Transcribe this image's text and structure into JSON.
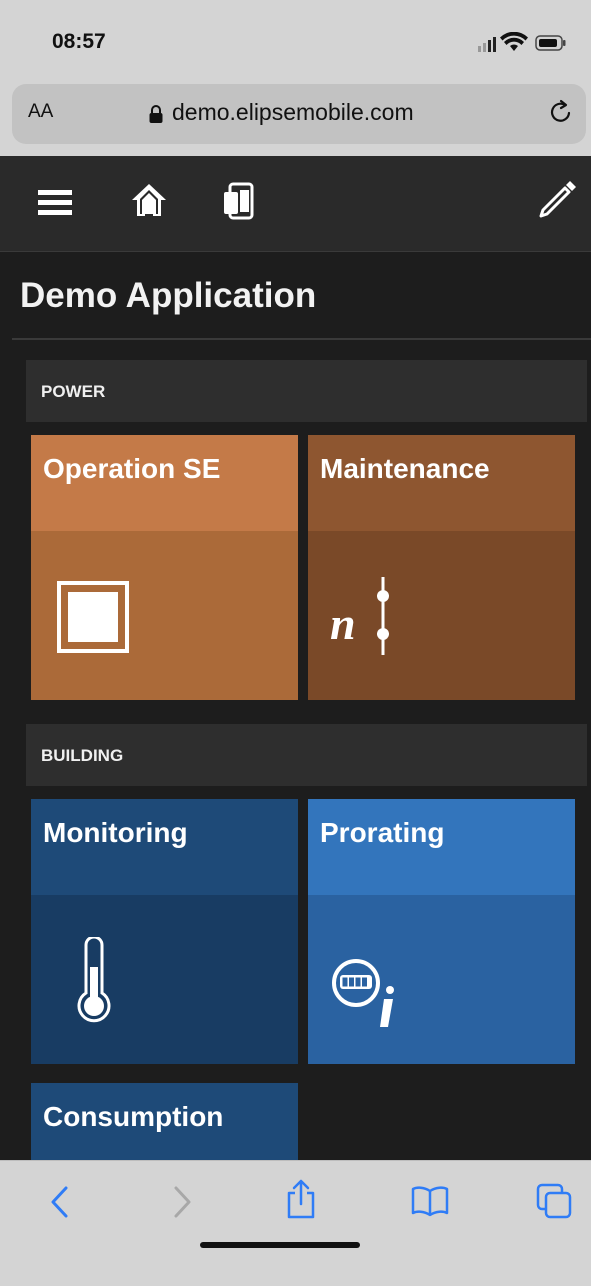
{
  "status_bar": {
    "time": "08:57"
  },
  "browser": {
    "text_size_label": "AA",
    "url": "demo.elipsemobile.com"
  },
  "app": {
    "title": "Demo Application",
    "sections": [
      {
        "label": "POWER",
        "tiles": [
          {
            "label": "Operation SE",
            "icon": "substation-icon"
          },
          {
            "label": "Maintenance",
            "icon": "maintenance-switch-icon"
          }
        ]
      },
      {
        "label": "BUILDING",
        "tiles": [
          {
            "label": "Monitoring",
            "icon": "thermometer-icon"
          },
          {
            "label": "Prorating",
            "icon": "meter-info-icon"
          },
          {
            "label": "Consumption",
            "icon": ""
          }
        ]
      }
    ],
    "navbar_icons": [
      "menu-icon",
      "home-icon",
      "device-icon",
      "edit-pencil-icon"
    ]
  },
  "toolbar_icons": [
    "back-icon",
    "forward-icon",
    "share-icon",
    "bookmarks-icon",
    "tabs-icon"
  ],
  "colors": {
    "power_tile_1_top": "#c47a48",
    "power_tile_1_body": "#ab6a39",
    "power_tile_2_top": "#8e5630",
    "power_tile_2_body": "#7a4928",
    "building_tile_1_top": "#1e4a78",
    "building_tile_1_body": "#183c63",
    "building_tile_2_top": "#3375bc",
    "building_tile_2_body": "#2a62a1",
    "ios_accent": "#2f7cf6"
  }
}
